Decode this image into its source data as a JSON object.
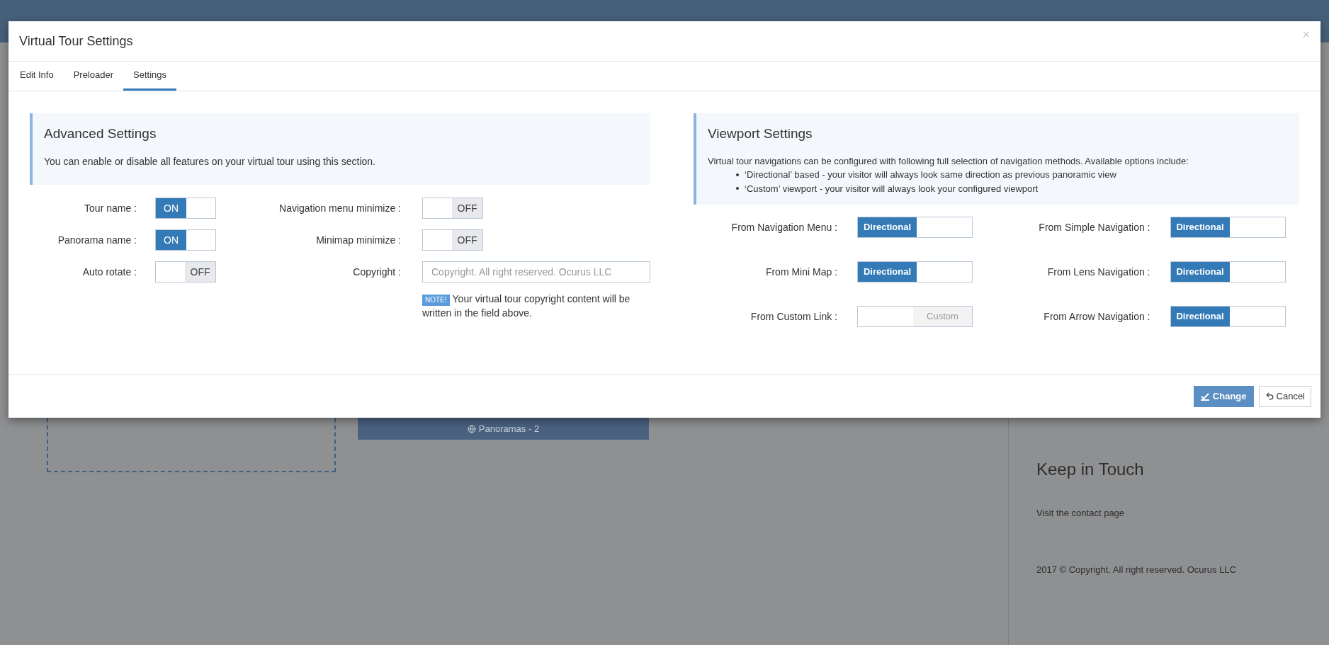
{
  "background": {
    "panoramas_button": "Panoramas - 2",
    "sidebar": {
      "heading": "Keep in Touch",
      "link": "Visit the contact page",
      "copyright": "2017 © Copyright. All right reserved. Ocurus LLC"
    }
  },
  "modal": {
    "title": "Virtual Tour Settings",
    "close": "×",
    "tabs": [
      {
        "label": "Edit Info",
        "selected": false
      },
      {
        "label": "Preloader",
        "selected": false
      },
      {
        "label": "Settings",
        "selected": true
      }
    ],
    "advanced": {
      "heading": "Advanced Settings",
      "description": "You can enable or disable all features on your virtual tour using this section.",
      "left_fields": [
        {
          "label": "Tour name :",
          "on": true,
          "text": "ON"
        },
        {
          "label": "Panorama name :",
          "on": true,
          "text": "ON"
        },
        {
          "label": "Auto rotate :",
          "on": false,
          "text": "OFF"
        }
      ],
      "right_fields": [
        {
          "kind": "switch",
          "label": "Navigation menu minimize :",
          "on": false,
          "text": "OFF"
        },
        {
          "kind": "switch",
          "label": "Minimap minimize :",
          "on": false,
          "text": "OFF"
        },
        {
          "kind": "input",
          "label": "Copyright :",
          "placeholder": "Copyright. All right reserved. Ocurus LLC"
        }
      ],
      "note_badge": "NOTE!",
      "note": "Your virtual tour copyright content will be written in the field above."
    },
    "viewport": {
      "heading": "Viewport Settings",
      "description": "Virtual tour navigations can be configured with following full selection of navigation methods. Available options include:",
      "bullets": [
        "‘Directional’ based - your visitor will always look same direction as previous panoramic view",
        "‘Custom’ viewport - your visitor will always look your configured viewport"
      ],
      "fields": [
        {
          "label": "From Navigation Menu :",
          "on": true,
          "text": "Directional"
        },
        {
          "label": "From Simple Navigation :",
          "on": true,
          "text": "Directional"
        },
        {
          "label": "From Mini Map :",
          "on": true,
          "text": "Directional"
        },
        {
          "label": "From Lens Navigation :",
          "on": true,
          "text": "Directional"
        },
        {
          "label": "From Custom Link :",
          "on": false,
          "text": "Custom"
        },
        {
          "label": "From Arrow Navigation :",
          "on": true,
          "text": "Directional"
        }
      ]
    },
    "buttons": {
      "primary": "Change",
      "secondary": "Cancel"
    }
  }
}
